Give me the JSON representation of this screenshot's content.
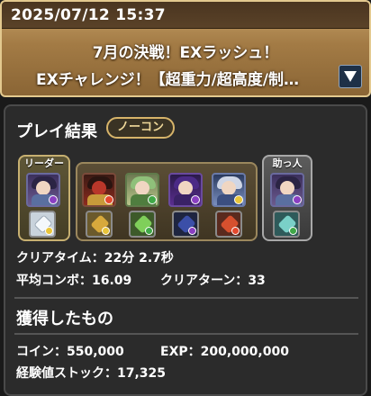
{
  "header": {
    "datetime": "2025/07/12 15:37",
    "title_line1": "7月の決戦！EXラッシュ！",
    "title_line2": "EXチャレンジ！【超重力/超高度/制…"
  },
  "result": {
    "title": "プレイ結果",
    "badge": "ノーコン",
    "team": {
      "leader_label": "リーダー",
      "helper_label": "助っ人",
      "leader": {
        "icon": "dark-haired-monster-icon",
        "orb": "dark",
        "assist": "white-figure-assist-icon"
      },
      "subs": [
        {
          "icon": "red-armored-monster-icon",
          "orb": "fire",
          "assist": "gold-weapon-assist-icon"
        },
        {
          "icon": "green-haired-monster-icon",
          "orb": "wood",
          "assist": "green-dragon-assist-icon"
        },
        {
          "icon": "purple-witch-monster-icon",
          "orb": "dark",
          "assist": "dark-crest-assist-icon"
        },
        {
          "icon": "blue-winged-monster-icon",
          "orb": "light",
          "assist": "red-hat-assist-icon"
        }
      ],
      "helper": {
        "icon": "dark-haired-monster-icon",
        "orb": "dark",
        "assist": "teal-figure-assist-icon"
      }
    },
    "clear_time_label": "クリアタイム：",
    "clear_time": "22分 2.7秒",
    "avg_combo_label": "平均コンボ：",
    "avg_combo": "16.09",
    "clear_turn_label": "クリアターン：",
    "clear_turn": "33"
  },
  "rewards": {
    "title": "獲得したもの",
    "coin_label": "コイン：",
    "coin": "550,000",
    "exp_label": "EXP：",
    "exp": "200,000,000",
    "exp_stock_label": "経験値ストック：",
    "exp_stock": "17,325"
  },
  "colors": {
    "fire": "#e4492e",
    "wood": "#3fa847",
    "light": "#e8c53a",
    "dark": "#8a3fc2"
  }
}
